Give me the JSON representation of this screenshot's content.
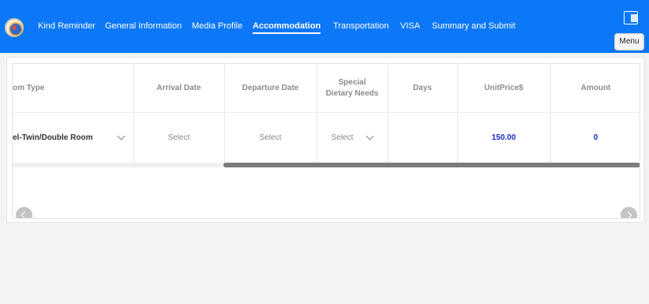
{
  "nav": {
    "items": [
      {
        "label": "Kind Reminder"
      },
      {
        "label": "General Information"
      },
      {
        "label": "Media Profile"
      },
      {
        "label": "Accommodation",
        "active": true
      },
      {
        "label": "Transportation"
      },
      {
        "label": "VISA"
      },
      {
        "label": "Summary and Submit"
      }
    ],
    "menu_label": "Menu",
    "language_icon": "language-switch-icon",
    "logo_icon": "emblem-logo"
  },
  "table": {
    "headers": [
      "om Type",
      "Arrival Date",
      "Departure Date",
      "Special Dietary Needs",
      "Days",
      "UnitPrice$",
      "Amount"
    ],
    "row": {
      "room_type": "el-Twin/Double Room",
      "arrival_date": "Select",
      "departure_date": "Select",
      "dietary": "Select",
      "days": "",
      "unit_price": "150.00",
      "amount": "0"
    },
    "horizontal_scroll_position": 0.98
  },
  "colors": {
    "topbar": "#0c78f7",
    "price_text": "#1428c8"
  }
}
